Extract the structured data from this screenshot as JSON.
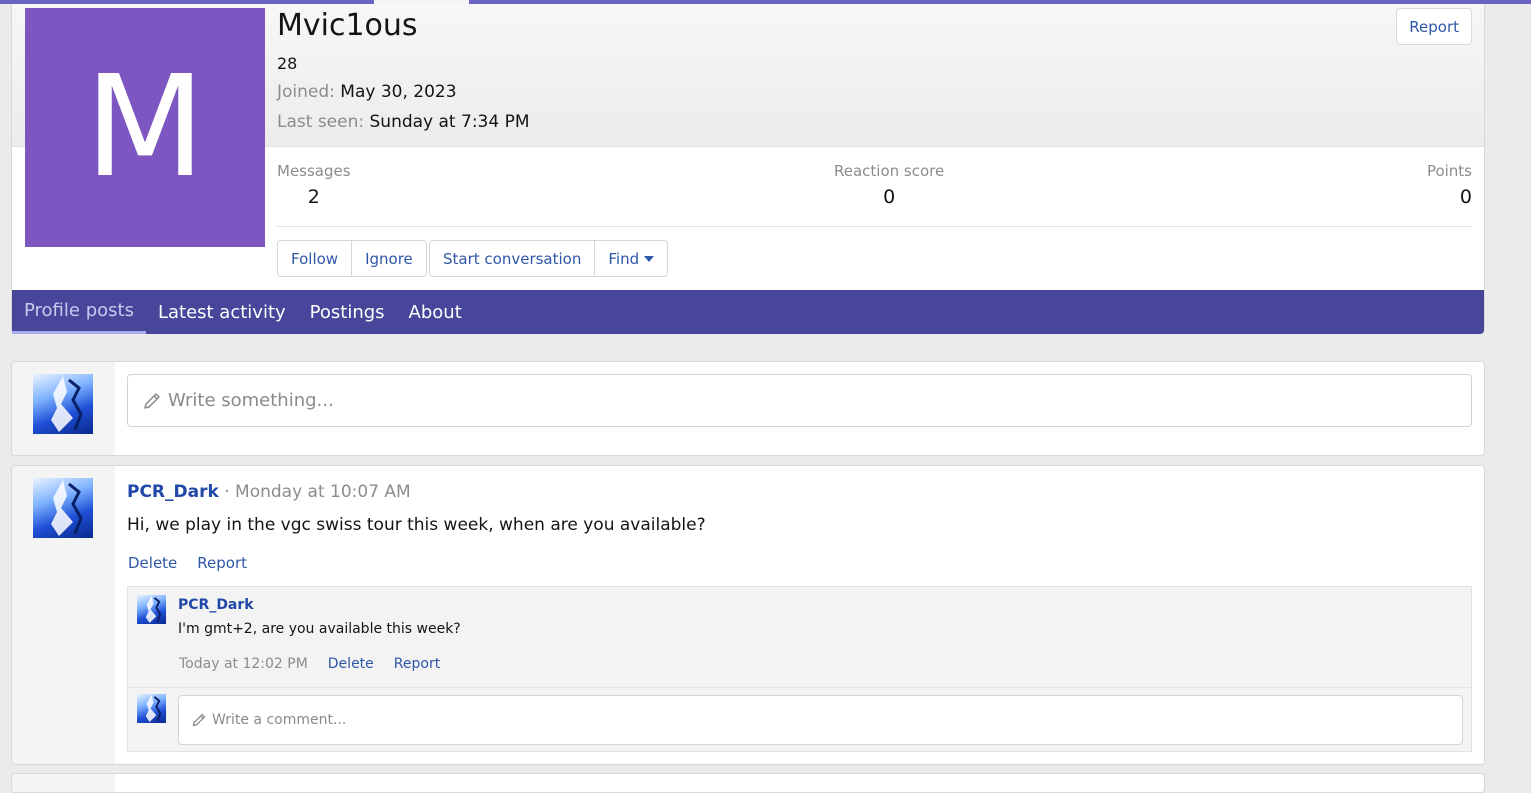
{
  "profile": {
    "avatar_letter": "M",
    "avatar_color": "#7e56c2",
    "username": "Mvic1ous",
    "user_title": "28",
    "joined_label": "Joined:",
    "joined_value": "May 30, 2023",
    "last_seen_label": "Last seen:",
    "last_seen_value": "Sunday at 7:34 PM",
    "report_label": "Report",
    "stats": [
      {
        "label": "Messages",
        "value": "2"
      },
      {
        "label": "Reaction score",
        "value": "0"
      },
      {
        "label": "Points",
        "value": "0"
      }
    ],
    "buttons": {
      "follow": "Follow",
      "ignore": "Ignore",
      "start_conversation": "Start conversation",
      "find": "Find"
    }
  },
  "tabs": [
    {
      "label": "Profile posts",
      "active": true
    },
    {
      "label": "Latest activity",
      "active": false
    },
    {
      "label": "Postings",
      "active": false
    },
    {
      "label": "About",
      "active": false
    }
  ],
  "composer": {
    "placeholder": "Write something..."
  },
  "post": {
    "author": "PCR_Dark",
    "separator": "·",
    "time": "Monday at 10:07 AM",
    "body": "Hi, we play in the vgc swiss tour this week, when are you available?",
    "actions": {
      "delete": "Delete",
      "report": "Report"
    },
    "comment": {
      "author": "PCR_Dark",
      "text": "I'm gmt+2, are you available this week?",
      "time": "Today at 12:02 PM",
      "delete": "Delete",
      "report": "Report"
    },
    "comment_placeholder": "Write a comment..."
  },
  "colors": {
    "nav_bar": "#47469a",
    "link": "#2f57a8",
    "author_link": "#2148a8",
    "accent_strip": "#6b63c4"
  },
  "icons": {
    "composer": "pencil-icon",
    "comment": "pencil-icon",
    "find_dropdown": "caret-down-icon"
  }
}
